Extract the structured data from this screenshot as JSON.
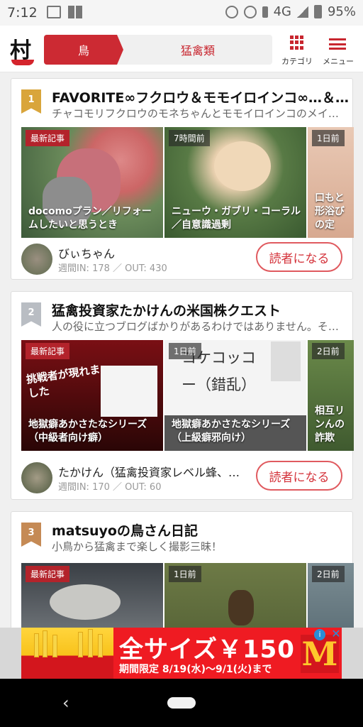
{
  "status": {
    "time": "7:12",
    "network": "4G",
    "battery": "95%"
  },
  "header": {
    "logo_text": "村",
    "breadcrumbs": [
      "鳥",
      "猛禽類"
    ],
    "category_label": "カテゴリ",
    "menu_label": "メニュー"
  },
  "cards": [
    {
      "rank": "1",
      "title": "FAVORITE∞フクロウ＆モモイロインコ∞…＆…",
      "desc": "チャコモリフクロウのモネちゃんとモモイロインコのメイ…",
      "thumbs": [
        {
          "tag": "最新記事",
          "caption": "docomoプラン／リフォームしたいと思うとき"
        },
        {
          "tag": "7時間前",
          "caption": "ニューウ・ガブリ・コーラル／自意識過剰"
        },
        {
          "tag": "1日前",
          "caption": "口もと形浴びの定"
        }
      ],
      "author": "びぃちゃん",
      "stats": "週間IN: 178 ／ OUT: 430",
      "follow": "読者になる"
    },
    {
      "rank": "2",
      "title": "猛禽投資家たかけんの米国株クエスト",
      "desc": "人の役に立つブログばかりがあるわけではありません。そ…",
      "thumbs": [
        {
          "tag": "最新記事",
          "caption": "地獄癖あかさたなシリーズ（中級者向け癖）",
          "overlay": "挑戦者が現れました"
        },
        {
          "tag": "1日前",
          "caption": "地獄癖あかさたなシリーズ（上級癖邪向け）",
          "overlay": "コケコッコー（錯乱）"
        },
        {
          "tag": "2日前",
          "caption": "相互リンんの詐欺"
        }
      ],
      "author": "たかけん（猛禽投資家レベル蜂、職…",
      "stats": "週間IN: 170 ／ OUT: 60",
      "follow": "読者になる"
    },
    {
      "rank": "3",
      "title": "matsuyoの鳥さん日記",
      "desc": "小鳥から猛禽まで楽しく撮影三昧！",
      "thumbs": [
        {
          "tag": "最新記事",
          "caption": ""
        },
        {
          "tag": "1日前",
          "caption": ""
        },
        {
          "tag": "2日前",
          "caption": ""
        }
      ]
    }
  ],
  "ad": {
    "headline": "全サイズ￥150",
    "subline": "期間限定 8/19(水)～9/1(火)まで",
    "brand": "M",
    "info": "i",
    "close": "✕"
  },
  "nav": {
    "back": "‹"
  }
}
